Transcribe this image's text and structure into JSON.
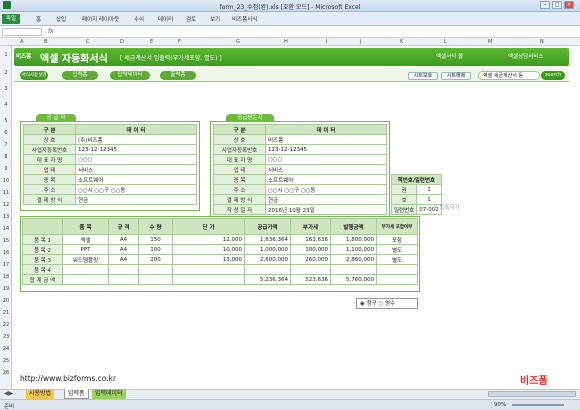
{
  "window": {
    "title": "form_23_수정(완).xls [호환 모드] - Microsoft Excel"
  },
  "ribbon": {
    "file": "파일",
    "tabs": [
      "홈",
      "삽입",
      "페이지 레이아웃",
      "수식",
      "데이터",
      "검토",
      "보기",
      "비즈폼서식"
    ]
  },
  "columns": [
    "A",
    "B",
    "C",
    "D",
    "E",
    "F",
    "G",
    "H",
    "I",
    "J",
    "K",
    "L",
    "M",
    "N"
  ],
  "rows": [
    "1",
    "2",
    "3",
    "4",
    "5",
    "6",
    "7",
    "8",
    "9",
    "10",
    "11",
    "12",
    "13",
    "14",
    "15",
    "16",
    "17",
    "18",
    "19",
    "20",
    "21",
    "22",
    "23",
    "24",
    "25",
    "26"
  ],
  "banner": {
    "logo": "비즈폼",
    "title": "엑셀 자동화서식",
    "subtitle": "[ 세금계산서 입출력(부가세포함, 별도) ]",
    "shop": "엑셀서식 몰",
    "consult": "엑셀상담서비스"
  },
  "nav": {
    "buttons": [
      "서식사용설명",
      "입력폼",
      "입력데이터",
      "출력폼"
    ],
    "btn_save": "시트보호",
    "btn_unlock": "시트해제",
    "search_value": "엑셀 세금계산서 등",
    "search_label": "search"
  },
  "supplier": {
    "title": "공 급 자",
    "head": [
      "구  분",
      "데  이  터"
    ],
    "rows": [
      [
        "상  호",
        "(주)비즈폼"
      ],
      [
        "사업자등록번호",
        "123-12-12345"
      ],
      [
        "대 표 자 명",
        "○○○"
      ],
      [
        "업  태",
        "서비스"
      ],
      [
        "종  목",
        "소프트웨어"
      ],
      [
        "주  소",
        "○○시 ○○구 ○○동"
      ],
      [
        "결 제 방 식",
        "현금"
      ]
    ]
  },
  "buyer": {
    "title": "공급받는자",
    "head": [
      "구  분",
      "데  이  터"
    ],
    "rows": [
      [
        "상  호",
        "비즈폼"
      ],
      [
        "사업자등록번호",
        "123-12-12345"
      ],
      [
        "대 표 자 명",
        "○○○"
      ],
      [
        "업  태",
        "서비스"
      ],
      [
        "종  목",
        "소프트웨어"
      ],
      [
        "주  소",
        "○○시 ○○구 ○○동"
      ],
      [
        "결 제 방 식",
        "현금"
      ],
      [
        "작 성 일 자",
        "2016년 10월 23일"
      ]
    ]
  },
  "book": {
    "head": "책번호/일련번호",
    "rows": [
      [
        "권",
        "1"
      ],
      [
        "호",
        "1"
      ],
      [
        "일련번호",
        "07-002"
      ]
    ],
    "register": "등록하기"
  },
  "items": {
    "head": [
      "",
      "품  목",
      "규 격",
      "수 량",
      "단 가",
      "공급가액",
      "부가세",
      "발행금액",
      "부가세\n포함여부"
    ],
    "rows": [
      [
        "품  목  1",
        "엑셀",
        "A4",
        "150",
        "12,000",
        "1,636,364",
        "163,636",
        "1,800,000",
        "포함"
      ],
      [
        "품  목  2",
        "PPT",
        "A4",
        "100",
        "10,000",
        "1,000,000",
        "100,000",
        "1,100,000",
        "별도"
      ],
      [
        "품  목  3",
        "워드템플릿",
        "A4",
        "200",
        "13,000",
        "2,600,000",
        "260,000",
        "2,860,000",
        "별도"
      ],
      [
        "품  목  4",
        "",
        "",
        "",
        "",
        "",
        "",
        "",
        ""
      ]
    ],
    "total": [
      "합 계 금 액",
      "",
      "",
      "",
      "",
      "5,236,364",
      "523,636",
      "5,760,000",
      ""
    ]
  },
  "radio": {
    "opt1": "청구",
    "opt2": "영수"
  },
  "footer": {
    "url": "http://www.bizforms.co.kr",
    "brand": "비즈폼"
  },
  "sheets": [
    "사용방법",
    "입력폼",
    "입력데이터"
  ],
  "status": {
    "ready": "준비",
    "zoom": "90%"
  }
}
